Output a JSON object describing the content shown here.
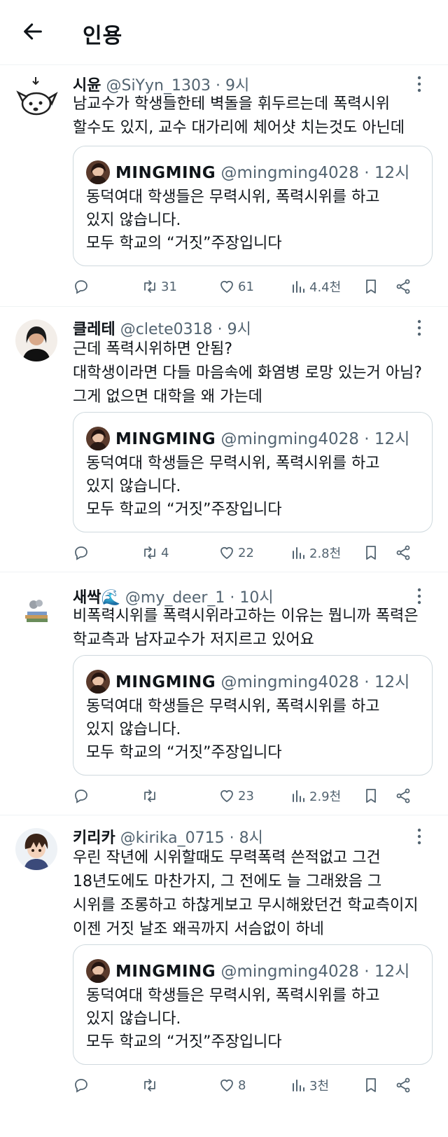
{
  "header": {
    "title": "인용"
  },
  "quoted_tweet": {
    "name": "MINGMING",
    "handle": "@mingming4028",
    "time": "12시",
    "text": "동덕여대 학생들은 무력시위, 폭력시위를 하고\n있지 않습니다.\n모두 학교의 “거짓”주장입니다"
  },
  "posts": [
    {
      "name": "시윤",
      "handle": "@SiYyn_1303",
      "time": "9시",
      "text": "남교수가 학생들한테 벽돌을 휘두르는데 폭력시위\n할수도 있지, 교수 대가리에 체어샷 치는것도 아닌데",
      "retweets": "31",
      "likes": "61",
      "views": "4.4천"
    },
    {
      "name": "클레테",
      "handle": "@clete0318",
      "time": "9시",
      "text": "근데 폭력시위하면 안됨?\n대학생이라면 다들 마음속에 화염병 로망 있는거 아님?\n그게 없으면 대학을 왜 가는데",
      "retweets": "4",
      "likes": "22",
      "views": "2.8천"
    },
    {
      "name": "새싹🌊",
      "handle": "@my_deer_1",
      "time": "10시",
      "text": "비폭력시위를 폭력시위라고하는 이유는 뭡니까 폭력은\n학교측과 남자교수가 저지르고 있어요",
      "retweets": "",
      "likes": "23",
      "views": "2.9천"
    },
    {
      "name": "키리카",
      "handle": "@kirika_0715",
      "time": "8시",
      "text": "우린 작년에 시위할때도 무력폭력 쓴적없고 그건\n18년도에도 마찬가지, 그 전에도 늘 그래왔음 그\n시위를 조롱하고 하찮게보고 무시해왔던건 학교측이지\n이젠 거짓 날조 왜곡까지 서슴없이 하네",
      "retweets": "",
      "likes": "8",
      "views": "3천"
    }
  ],
  "colors": {
    "text": "#0f1419",
    "secondary": "#536471",
    "border": "#cfd9de",
    "divider": "#eff3f4"
  }
}
